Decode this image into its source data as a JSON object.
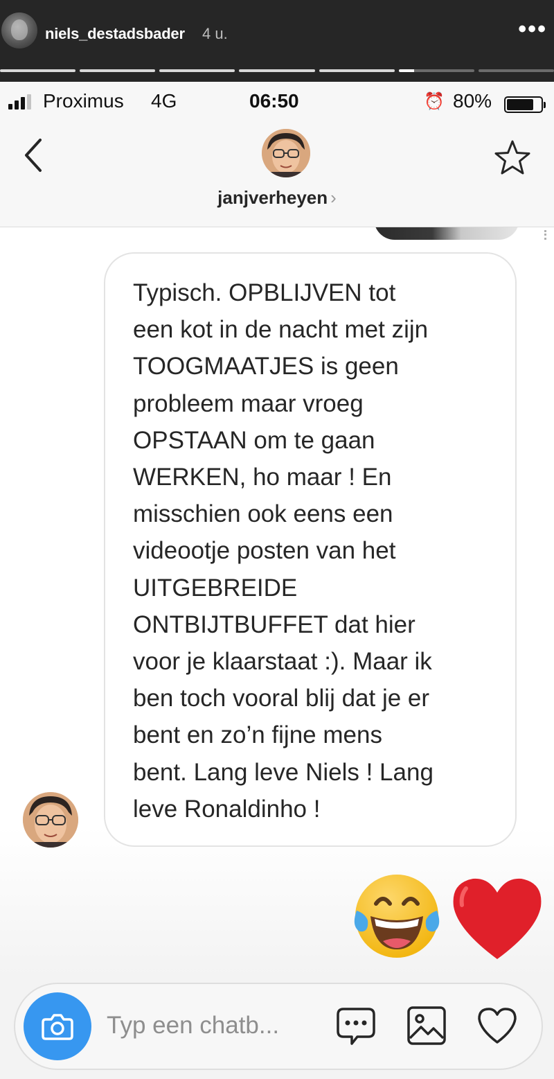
{
  "story": {
    "username": "niels_destadsbader",
    "time": "4 u.",
    "more_icon": "more-horizontal-icon",
    "more_label": "•••",
    "progress_segments": 7,
    "current_segment": 6,
    "current_segment_progress": 0.2
  },
  "status_bar": {
    "carrier": "Proximus",
    "network": "4G",
    "time": "06:50",
    "alarm_icon": "alarm-icon",
    "alarm_glyph": "⏰",
    "battery_percent": "80%",
    "battery_level": 0.8
  },
  "chat_header": {
    "back_icon": "chevron-left-icon",
    "name": "janjverheyen",
    "name_chevron": "›",
    "star_icon": "star-outline-icon"
  },
  "message": {
    "text": "Typisch. OPBLIJVEN tot\neen kot in de nacht met zijn\nTOOGMAATJES is geen\nprobleem maar vroeg\nOPSTAAN om te gaan\nWERKEN, ho maar ! En\nmisschien ook eens een\nvideootje posten van het\nUITGEBREIDE\nONTBIJTBUFFET dat hier\nvoor je klaarstaat :). Maar ik\nben toch vooral blij dat je er\nbent en zo’n fijne mens\nbent. Lang leve Niels ! Lang\nleve Ronaldinho !"
  },
  "reactions": [
    "face-with-tears-of-joy-emoji",
    "red-heart-emoji"
  ],
  "composer": {
    "placeholder": "Typ een chatb...",
    "camera_icon": "camera-icon",
    "sticker_icon": "sticker-bubble-icon",
    "gallery_icon": "image-icon",
    "like_icon": "heart-outline-icon"
  },
  "colors": {
    "accent": "#3797f0",
    "story_bg": "#262626",
    "header_bg": "#f7f7f7",
    "bubble_border": "#e3e3e3",
    "heart": "#e0202a"
  }
}
